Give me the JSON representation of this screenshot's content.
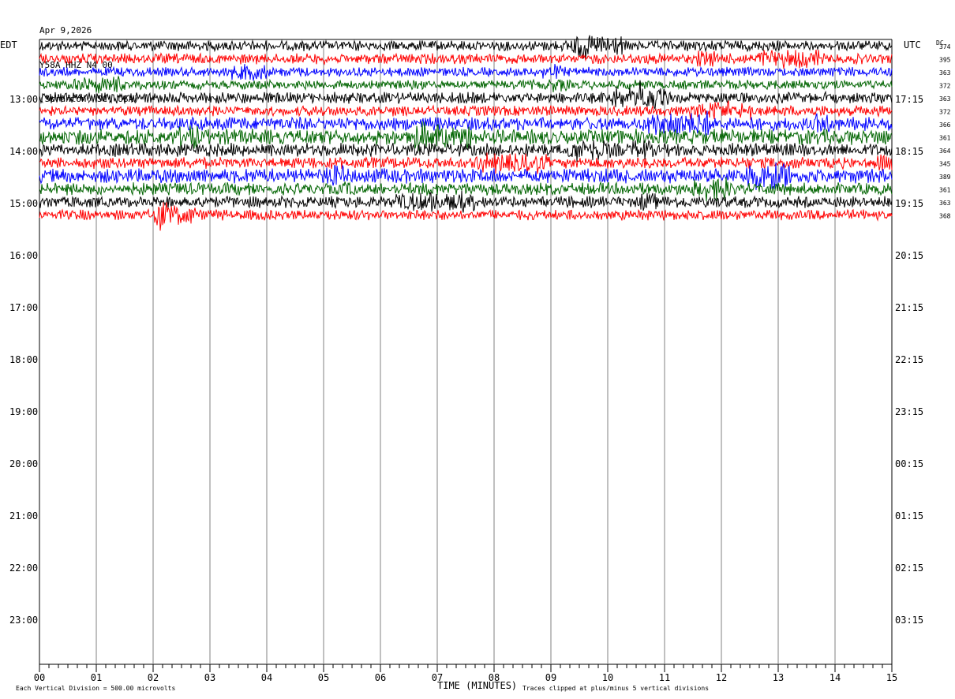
{
  "header": {
    "date": "Apr 9,2026",
    "station": "Y58A HHZ N4 00",
    "location": "(Scranton, SC, USA)"
  },
  "chart_data": {
    "type": "line",
    "title": "",
    "left_zone": "EDT",
    "right_zone": "UTC",
    "dc_label": "DC",
    "xlabel": "TIME (MINUTES)",
    "x_ticks": [
      "00",
      "01",
      "02",
      "03",
      "04",
      "05",
      "06",
      "07",
      "08",
      "09",
      "10",
      "11",
      "12",
      "13",
      "14",
      "15"
    ],
    "xlim": [
      0,
      15
    ],
    "left_hour_labels": [
      "13:00",
      "14:00",
      "15:00",
      "16:00",
      "17:00",
      "18:00",
      "19:00",
      "20:00",
      "21:00",
      "22:00",
      "23:00"
    ],
    "right_hour_labels": [
      "17:15",
      "18:15",
      "19:15",
      "20:15",
      "21:15",
      "22:15",
      "23:15",
      "00:15",
      "01:15",
      "02:15",
      "03:15"
    ],
    "trace_colors": [
      "#000000",
      "#ff0000",
      "#0000ff",
      "#006400"
    ],
    "dc_values": [
      "374",
      "395",
      "363",
      "372",
      "363",
      "372",
      "366",
      "361",
      "364",
      "345",
      "389",
      "361",
      "363",
      "368"
    ],
    "trace_amplitude": [
      1.0,
      1.0,
      0.9,
      0.9,
      1.1,
      1.0,
      1.3,
      1.5,
      1.3,
      1.1,
      1.4,
      1.2,
      1.1,
      1.0
    ],
    "footer_left": "Each Vertical Division =  500.00 microvolts",
    "footer_right": "Traces clipped at plus/minus 5 vertical divisions"
  }
}
